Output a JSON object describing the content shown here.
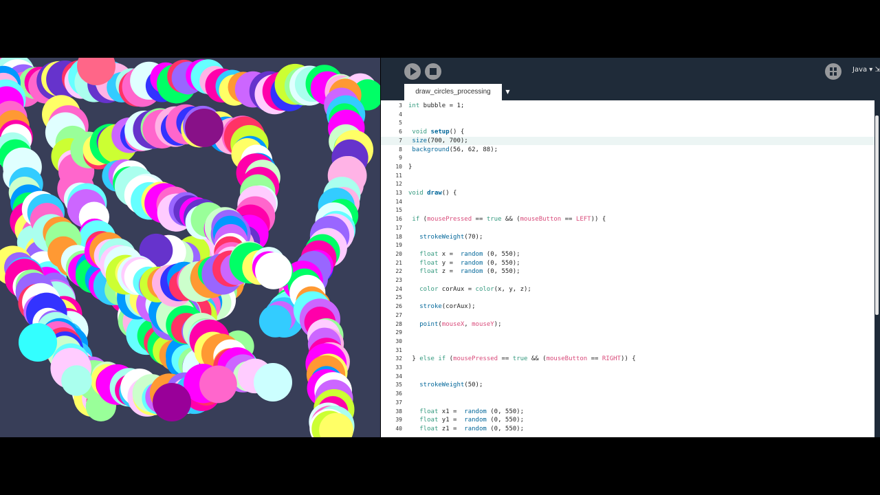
{
  "toolbar": {
    "run_icon": "play-icon",
    "stop_icon": "stop-icon",
    "debug_icon": "butterfly-icon",
    "mode_label": "Java ▾ ⇲"
  },
  "tab": {
    "label": "draw_circles_processing",
    "menu_arrow": "▼"
  },
  "sketch": {
    "background": "#383e58"
  },
  "editor": {
    "lines": [
      {
        "n": "3",
        "code": "int bubble = 1;"
      },
      {
        "n": "4",
        "code": ""
      },
      {
        "n": "5",
        "code": ""
      },
      {
        "n": "6",
        "code": " void setup() {"
      },
      {
        "n": "7",
        "code": " size(700, 700);"
      },
      {
        "n": "8",
        "code": " background(56, 62, 88);"
      },
      {
        "n": "9",
        "code": ""
      },
      {
        "n": "10",
        "code": "}"
      },
      {
        "n": "11",
        "code": ""
      },
      {
        "n": "12",
        "code": ""
      },
      {
        "n": "13",
        "code": "void draw() {"
      },
      {
        "n": "14",
        "code": ""
      },
      {
        "n": "15",
        "code": ""
      },
      {
        "n": "16",
        "code": " if (mousePressed == true && (mouseButton == LEFT)) {"
      },
      {
        "n": "17",
        "code": ""
      },
      {
        "n": "18",
        "code": "   strokeWeight(70);"
      },
      {
        "n": "19",
        "code": ""
      },
      {
        "n": "20",
        "code": "   float x =  random (0, 550);"
      },
      {
        "n": "21",
        "code": "   float y =  random (0, 550);"
      },
      {
        "n": "22",
        "code": "   float z =  random (0, 550);"
      },
      {
        "n": "23",
        "code": ""
      },
      {
        "n": "24",
        "code": "   color corAux = color(x, y, z);"
      },
      {
        "n": "25",
        "code": ""
      },
      {
        "n": "26",
        "code": "   stroke(corAux);"
      },
      {
        "n": "27",
        "code": ""
      },
      {
        "n": "28",
        "code": "   point(mouseX, mouseY);"
      },
      {
        "n": "29",
        "code": ""
      },
      {
        "n": "30",
        "code": ""
      },
      {
        "n": "31",
        "code": ""
      },
      {
        "n": "32",
        "code": " } else if (mousePressed == true && (mouseButton == RIGHT)) {"
      },
      {
        "n": "33",
        "code": ""
      },
      {
        "n": "34",
        "code": ""
      },
      {
        "n": "35",
        "code": "   strokeWeight(50);"
      },
      {
        "n": "36",
        "code": ""
      },
      {
        "n": "37",
        "code": ""
      },
      {
        "n": "38",
        "code": "   float x1 =  random (0, 550);"
      },
      {
        "n": "39",
        "code": "   float y1 =  random (0, 550);"
      },
      {
        "n": "40",
        "code": "   float z1 =  random (0, 550);"
      }
    ],
    "highlight_line": "7"
  }
}
